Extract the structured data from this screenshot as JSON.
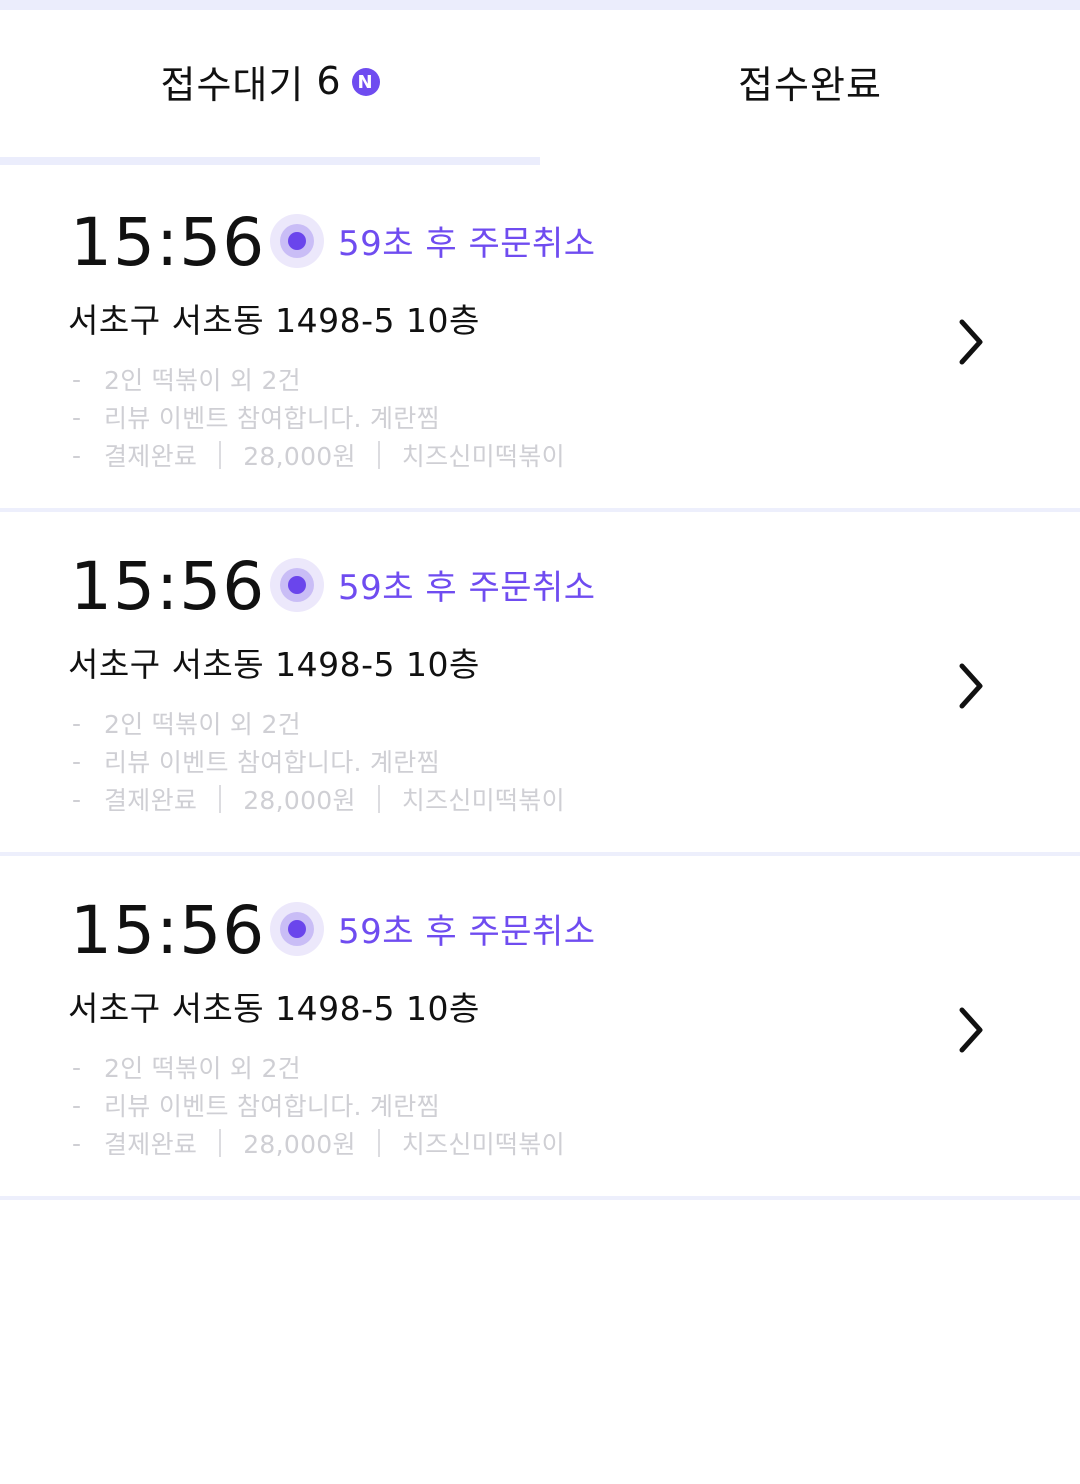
{
  "tabs": {
    "pending_label": "접수대기",
    "pending_count": "6",
    "pending_badge": "N",
    "done_label": "접수완료"
  },
  "orders": [
    {
      "time": "15:56",
      "countdown": "59초 후 주문취소",
      "address": "서초구 서초동 1498-5 10층",
      "dash": "-",
      "item_summary": "2인 떡볶이 외 2건",
      "request": "리뷰 이벤트 참여합니다. 계란찜",
      "payment_status": "결제완료",
      "price": "28,000원",
      "menu": "치즈신미떡볶이"
    },
    {
      "time": "15:56",
      "countdown": "59초 후 주문취소",
      "address": "서초구 서초동 1498-5 10층",
      "dash": "-",
      "item_summary": "2인 떡볶이 외 2건",
      "request": "리뷰 이벤트 참여합니다. 계란찜",
      "payment_status": "결제완료",
      "price": "28,000원",
      "menu": "치즈신미떡볶이"
    },
    {
      "time": "15:56",
      "countdown": "59초 후 주문취소",
      "address": "서초구 서초동 1498-5 10층",
      "dash": "-",
      "item_summary": "2인 떡볶이 외 2건",
      "request": "리뷰 이벤트 참여합니다. 계란찜",
      "payment_status": "결제완료",
      "price": "28,000원",
      "menu": "치즈신미떡볶이"
    }
  ],
  "colors": {
    "accent": "#6f4cf0",
    "divider": "#ebedfc",
    "muted_text": "#cfcfd4"
  },
  "icons": {
    "pulse": "pulse-dot-icon",
    "chevron": "chevron-right-icon"
  }
}
